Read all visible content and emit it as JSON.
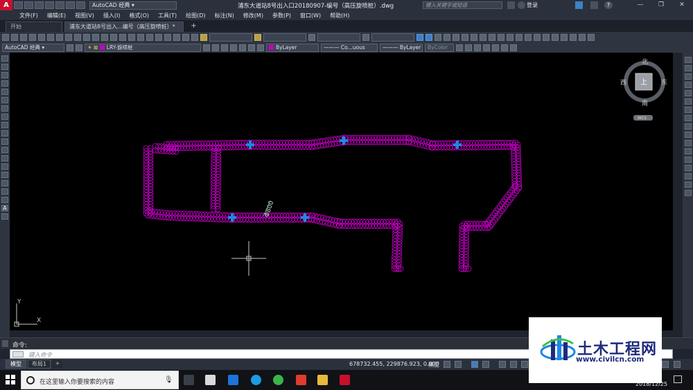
{
  "titlebar": {
    "workspace": "AutoCAD 经典",
    "document_title": "浦东大道站8号出入口20180907-编号（高压旋喷桩）.dwg",
    "search_placeholder": "键入关键字或短语",
    "login": "登录"
  },
  "menu": [
    "文件(F)",
    "编辑(E)",
    "视图(V)",
    "插入(I)",
    "格式(O)",
    "工具(T)",
    "绘图(D)",
    "标注(N)",
    "修改(M)",
    "参数(P)",
    "窗口(W)",
    "帮助(H)"
  ],
  "tabs": {
    "start": "开始",
    "drawing": "浦东大道站8号出入...编号（高压旋喷桩）*",
    "add": "+"
  },
  "toolbar": {
    "workspace": "AutoCAD 经典",
    "layer": "LRY-旋喷桩",
    "color": "ByLayer",
    "linetype": "Co...uous",
    "lineweight": "ByLayer",
    "plotstyle": "ByColor"
  },
  "viewcube": {
    "north": "北",
    "south": "南",
    "east": "东",
    "west": "西",
    "top": "上",
    "wcs": "WCS"
  },
  "drawing": {
    "annotation": "Φ800",
    "ucs_x": "X",
    "ucs_y": "Y",
    "pile_color": "#c400c4",
    "marker_color": "#1e88e5"
  },
  "command": {
    "label": "命令:",
    "placeholder": "键入命令"
  },
  "layout_tabs": {
    "model": "模型",
    "layout1": "布局1",
    "add": "+"
  },
  "status": {
    "coordinates": "678732.455, 229876.923, 0.000",
    "space": "模型"
  },
  "taskbar": {
    "search_placeholder": "在这里输入你要搜索的内容",
    "date": "2018/12/25"
  },
  "watermark": {
    "title": "土木工程网",
    "url": "www.civilcn.com"
  }
}
